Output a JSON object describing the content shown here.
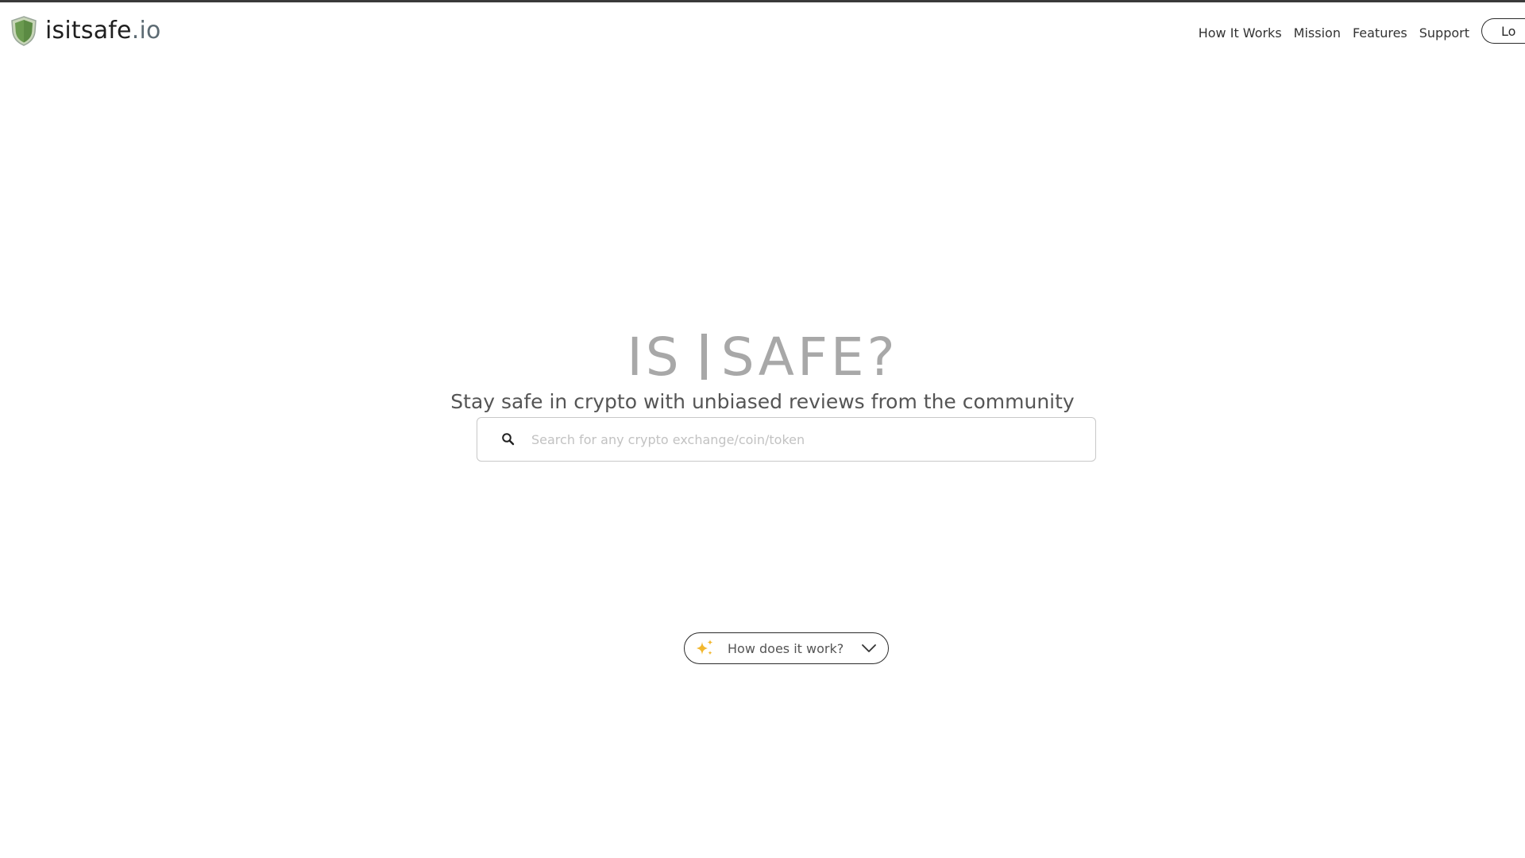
{
  "brand": {
    "name": "isitsafe",
    "tld": ".io",
    "icon": "shield-icon",
    "shield_color": "#6a9a4f"
  },
  "nav": {
    "items": [
      {
        "label": "How It Works"
      },
      {
        "label": "Mission"
      },
      {
        "label": "Features"
      },
      {
        "label": "Support"
      }
    ],
    "login_label": "Lo"
  },
  "hero": {
    "title_left": "IS",
    "title_right": "SAFE?",
    "subtitle": "Stay safe in crypto with unbiased reviews from the community"
  },
  "search": {
    "icon": "search-icon",
    "placeholder": "Search for any crypto exchange/coin/token",
    "value": ""
  },
  "how_it_works": {
    "label": "How does it work?",
    "icon": "sparkle-icon",
    "chevron": "chevron-down-icon",
    "sparkle_color": "#f2b72e"
  }
}
